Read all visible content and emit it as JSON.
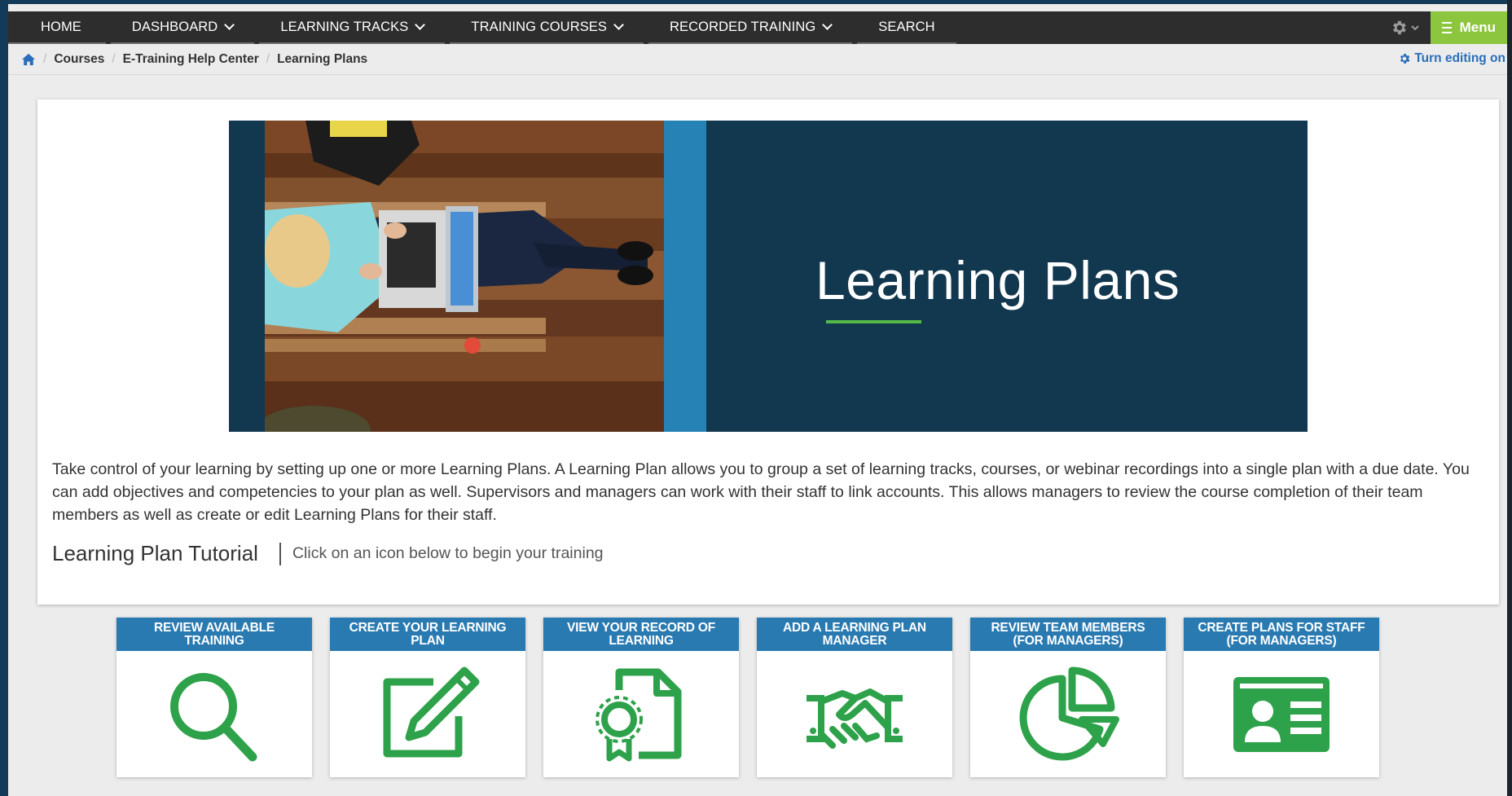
{
  "nav": {
    "items": [
      {
        "label": "HOME",
        "dropdown": false
      },
      {
        "label": "DASHBOARD",
        "dropdown": true
      },
      {
        "label": "LEARNING TRACKS",
        "dropdown": true
      },
      {
        "label": "TRAINING COURSES",
        "dropdown": true
      },
      {
        "label": "RECORDED TRAINING",
        "dropdown": true
      },
      {
        "label": "SEARCH",
        "dropdown": false
      }
    ],
    "menu_label": "Menu"
  },
  "breadcrumb": {
    "items": [
      "Courses",
      "E-Training Help Center",
      "Learning Plans"
    ],
    "turn_editing": "Turn editing on"
  },
  "banner": {
    "title": "Learning Plans"
  },
  "intro": "Take control of your learning by setting up one or more Learning Plans. A Learning Plan allows you to group a set of learning tracks, courses, or webinar recordings into a single plan with a due date. You can add objectives and competencies to your plan as well.  Supervisors and managers can work with their staff to link accounts.  This allows managers to review the course completion of their team members as well as create or edit Learning Plans for their staff.",
  "tutorial": {
    "title": "Learning Plan Tutorial",
    "subtitle": "Click on an icon below to begin your training"
  },
  "tiles": [
    {
      "label": "Review Available Training",
      "icon": "search-icon"
    },
    {
      "label": "Create Your Learning Plan",
      "icon": "edit-icon"
    },
    {
      "label": "View Your Record of Learning",
      "icon": "certificate-icon"
    },
    {
      "label": "Add a Learning Plan Manager",
      "icon": "handshake-icon"
    },
    {
      "label": "Review Team Members (for Managers)",
      "icon": "pie-chart-icon"
    },
    {
      "label": "Create Plans for Staff (for Managers)",
      "icon": "id-card-icon"
    }
  ],
  "colors": {
    "nav_bg": "#2d2d2d",
    "menu_green": "#8cc63f",
    "banner_navy": "#12384f",
    "tile_header_blue": "#2a7ab2",
    "icon_green": "#2ea24a",
    "link_blue": "#2a6ebb"
  }
}
